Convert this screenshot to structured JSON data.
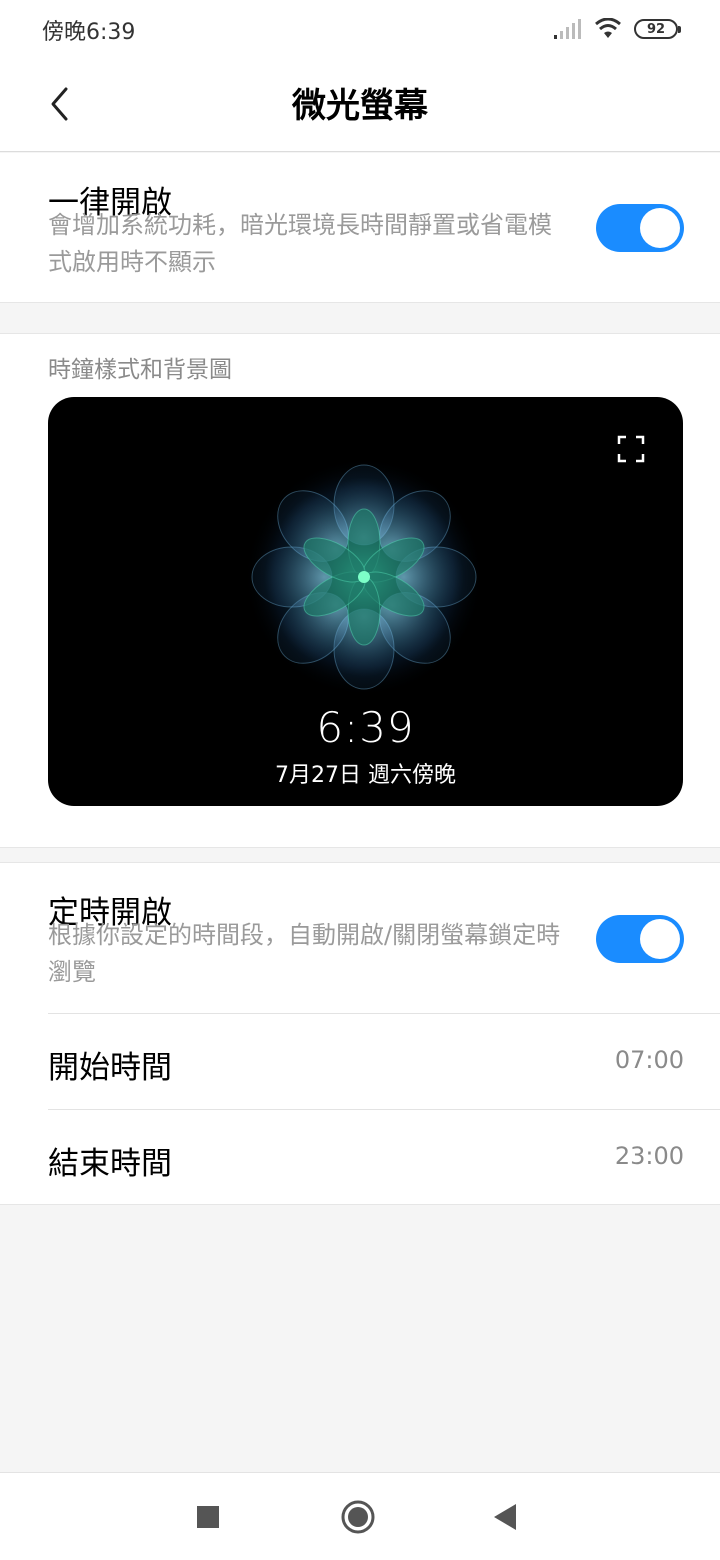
{
  "status_bar": {
    "time": "傍晚6:39",
    "battery": "92",
    "icons": [
      "signal-icon",
      "wifi-icon",
      "battery-icon"
    ]
  },
  "header": {
    "title": "微光螢幕",
    "back_icon": "chevron-left-icon"
  },
  "always_on": {
    "title": "一律開啟",
    "description": "會增加系統功耗，暗光環境長時間靜置或省電模式啟用時不顯示",
    "enabled": true
  },
  "clock_style": {
    "label": "時鐘樣式和背景圖",
    "preview_time": "6:39",
    "preview_date": "7月27日 週六傍晚",
    "expand_icon": "fullscreen-icon"
  },
  "scheduled": {
    "title": "定時開啟",
    "description": "根據你設定的時間段，自動開啟/關閉螢幕鎖定時瀏覽",
    "enabled": true,
    "start_label": "開始時間",
    "start_value": "07:00",
    "end_label": "結束時間",
    "end_value": "23:00"
  },
  "nav": {
    "recents_icon": "square-icon",
    "home_icon": "circle-icon",
    "back_icon": "triangle-back-icon"
  },
  "colors": {
    "accent": "#1a8cff",
    "background": "#f5f5f5",
    "secondary_text": "#9a9a9a"
  }
}
